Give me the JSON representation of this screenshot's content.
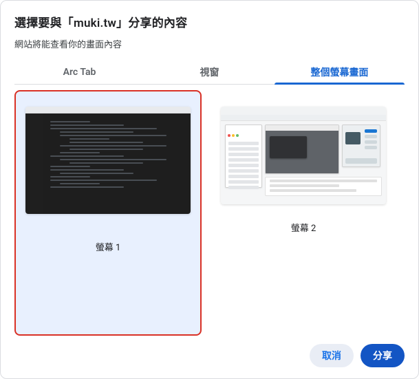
{
  "header": {
    "title": "選擇要與「muki.tw」分享的內容",
    "subtitle": "網站將能查看你的畫面內容"
  },
  "tabs": [
    {
      "id": "arc-tab",
      "label": "Arc Tab",
      "active": false
    },
    {
      "id": "window",
      "label": "視窗",
      "active": false
    },
    {
      "id": "entire-screen",
      "label": "整個螢幕畫面",
      "active": true
    }
  ],
  "screens": [
    {
      "id": "screen-1",
      "label": "螢幕 1",
      "selected": true
    },
    {
      "id": "screen-2",
      "label": "螢幕 2",
      "selected": false
    }
  ],
  "footer": {
    "cancel": "取消",
    "share": "分享"
  },
  "colors": {
    "accent": "#1967d2",
    "selection_border": "#d93025",
    "selection_fill": "#e8f0fe",
    "primary_button": "#1355c4"
  }
}
